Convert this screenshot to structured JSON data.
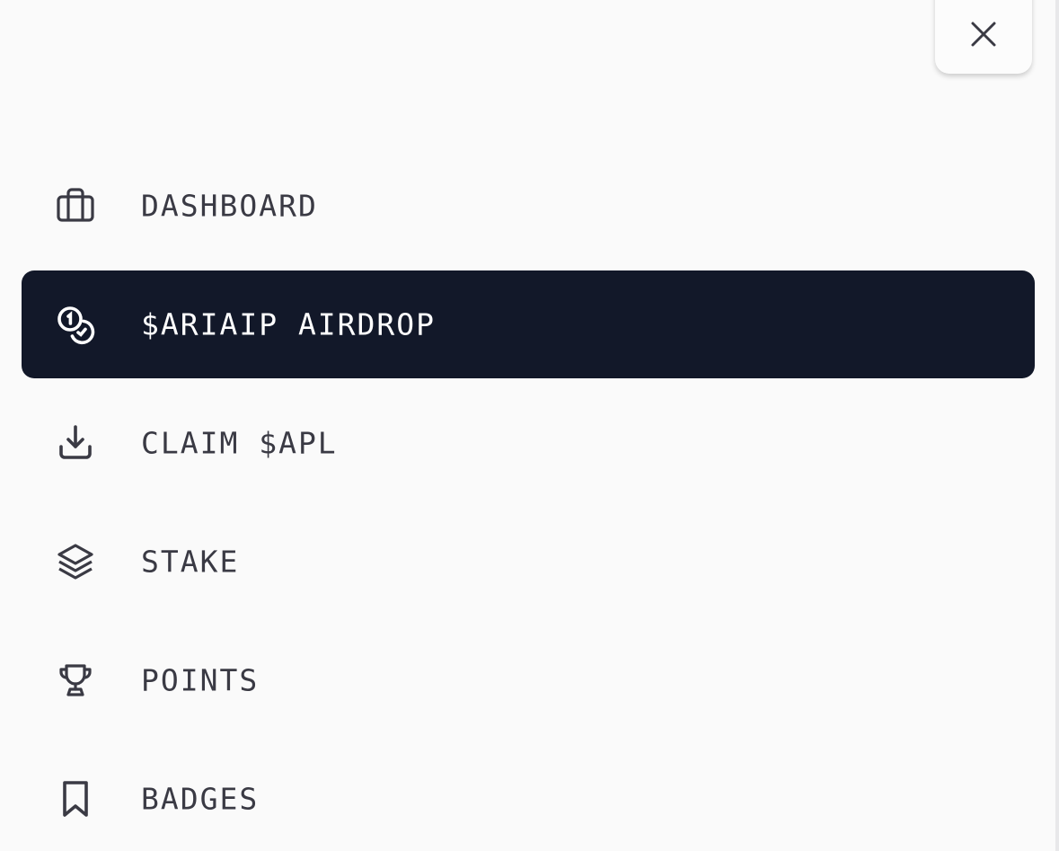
{
  "close_button": {
    "icon": "close-icon"
  },
  "nav": {
    "items": [
      {
        "label": "DASHBOARD",
        "icon": "briefcase-icon",
        "active": false
      },
      {
        "label": "$ARIAIP AIRDROP",
        "icon": "coins-icon",
        "active": true
      },
      {
        "label": "CLAIM $APL",
        "icon": "download-icon",
        "active": false
      },
      {
        "label": "STAKE",
        "icon": "layers-icon",
        "active": false
      },
      {
        "label": "POINTS",
        "icon": "trophy-icon",
        "active": false
      },
      {
        "label": "BADGES",
        "icon": "bookmark-icon",
        "active": false
      }
    ]
  },
  "colors": {
    "background": "#fafafa",
    "active_bg": "#121829",
    "active_text": "#ffffff",
    "text": "#3a3a44"
  }
}
